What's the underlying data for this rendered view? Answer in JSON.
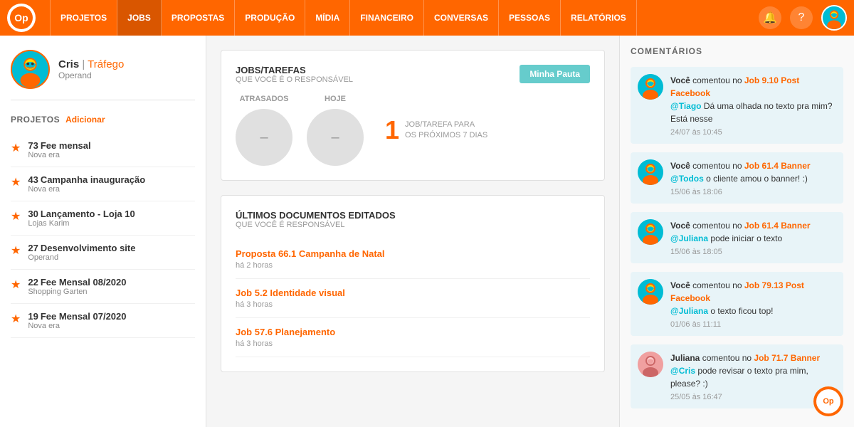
{
  "nav": {
    "logo": "Op",
    "items": [
      {
        "label": "PROJETOS",
        "active": false
      },
      {
        "label": "JOBS",
        "active": true
      },
      {
        "label": "PROPOSTAS",
        "active": false
      },
      {
        "label": "PRODUÇÃO",
        "active": false
      },
      {
        "label": "MÍDIA",
        "active": false
      },
      {
        "label": "FINANCEIRO",
        "active": false
      },
      {
        "label": "CONVERSAS",
        "active": false
      },
      {
        "label": "PESSOAS",
        "active": false
      },
      {
        "label": "RELATÓRIOS",
        "active": false
      }
    ]
  },
  "user": {
    "name": "Cris",
    "department": "Tráfego",
    "company": "Operand"
  },
  "projects": {
    "section_title": "PROJETOS",
    "add_label": "Adicionar",
    "items": [
      {
        "num": 73,
        "name": "Fee mensal",
        "client": "Nova era"
      },
      {
        "num": 43,
        "name": "Campanha inauguração",
        "client": "Nova era"
      },
      {
        "num": 30,
        "name": "Lançamento - Loja 10",
        "client": "Lojas Karim"
      },
      {
        "num": 27,
        "name": "Desenvolvimento site",
        "client": "Operand"
      },
      {
        "num": 22,
        "name": "Fee Mensal 08/2020",
        "client": "Shopping Garten"
      },
      {
        "num": 19,
        "name": "Fee Mensal 07/2020",
        "client": "Nova era"
      }
    ]
  },
  "jobs_card": {
    "title": "JOBS/TAREFAS",
    "subtitle": "QUE VOCÊ É O RESPONSÁVEL",
    "btn_label": "Minha Pauta",
    "late_label": "ATRASADOS",
    "today_label": "HOJE",
    "count": "1",
    "count_desc_line1": "JOB/TAREFA PARA",
    "count_desc_line2": "OS PRÓXIMOS 7 DIAS"
  },
  "docs_card": {
    "title": "ÚLTIMOS DOCUMENTOS EDITADOS",
    "subtitle": "QUE VOCÊ É RESPONSÁVEL",
    "items": [
      {
        "label": "Proposta 66.1 Campanha de Natal",
        "time": "há 2 horas"
      },
      {
        "label": "Job 5.2 Identidade visual",
        "time": "há 3 horas"
      },
      {
        "label": "Job 57.6 Planejamento",
        "time": "há 3 horas"
      }
    ]
  },
  "comments": {
    "title": "COMENTÁRIOS",
    "items": [
      {
        "author": "Você",
        "action": "comentou no",
        "link": "Job 9.10 Post Facebook",
        "mention": "@Tiago",
        "text": "Dá uma olhada no texto pra mim? Está nesse",
        "date": "24/07 às 10:45",
        "avatar_color": "#00BCD4",
        "is_own": true
      },
      {
        "author": "Você",
        "action": "comentou no",
        "link": "Job 61.4 Banner",
        "mention": "@Todos",
        "text": "o cliente amou o banner! :)",
        "date": "15/06 às 18:06",
        "avatar_color": "#00BCD4",
        "is_own": true
      },
      {
        "author": "Você",
        "action": "comentou no",
        "link": "Job 61.4 Banner",
        "mention": "@Juliana",
        "text": "pode iniciar o texto",
        "date": "15/06 às 18:05",
        "avatar_color": "#00BCD4",
        "is_own": true
      },
      {
        "author": "Você",
        "action": "comentou no",
        "link": "Job 79.13 Post Facebook",
        "mention": "@Juliana",
        "text": "o texto ficou top!",
        "date": "01/06 às 11:11",
        "avatar_color": "#00BCD4",
        "is_own": true
      },
      {
        "author": "Juliana",
        "action": "comentou no",
        "link": "Job 71.7 Banner",
        "mention": "@Cris",
        "text": "pode revisar o texto pra mim, please? :)",
        "date": "25/05 às 16:47",
        "avatar_color": "#f0a0a0",
        "is_own": false
      }
    ]
  }
}
